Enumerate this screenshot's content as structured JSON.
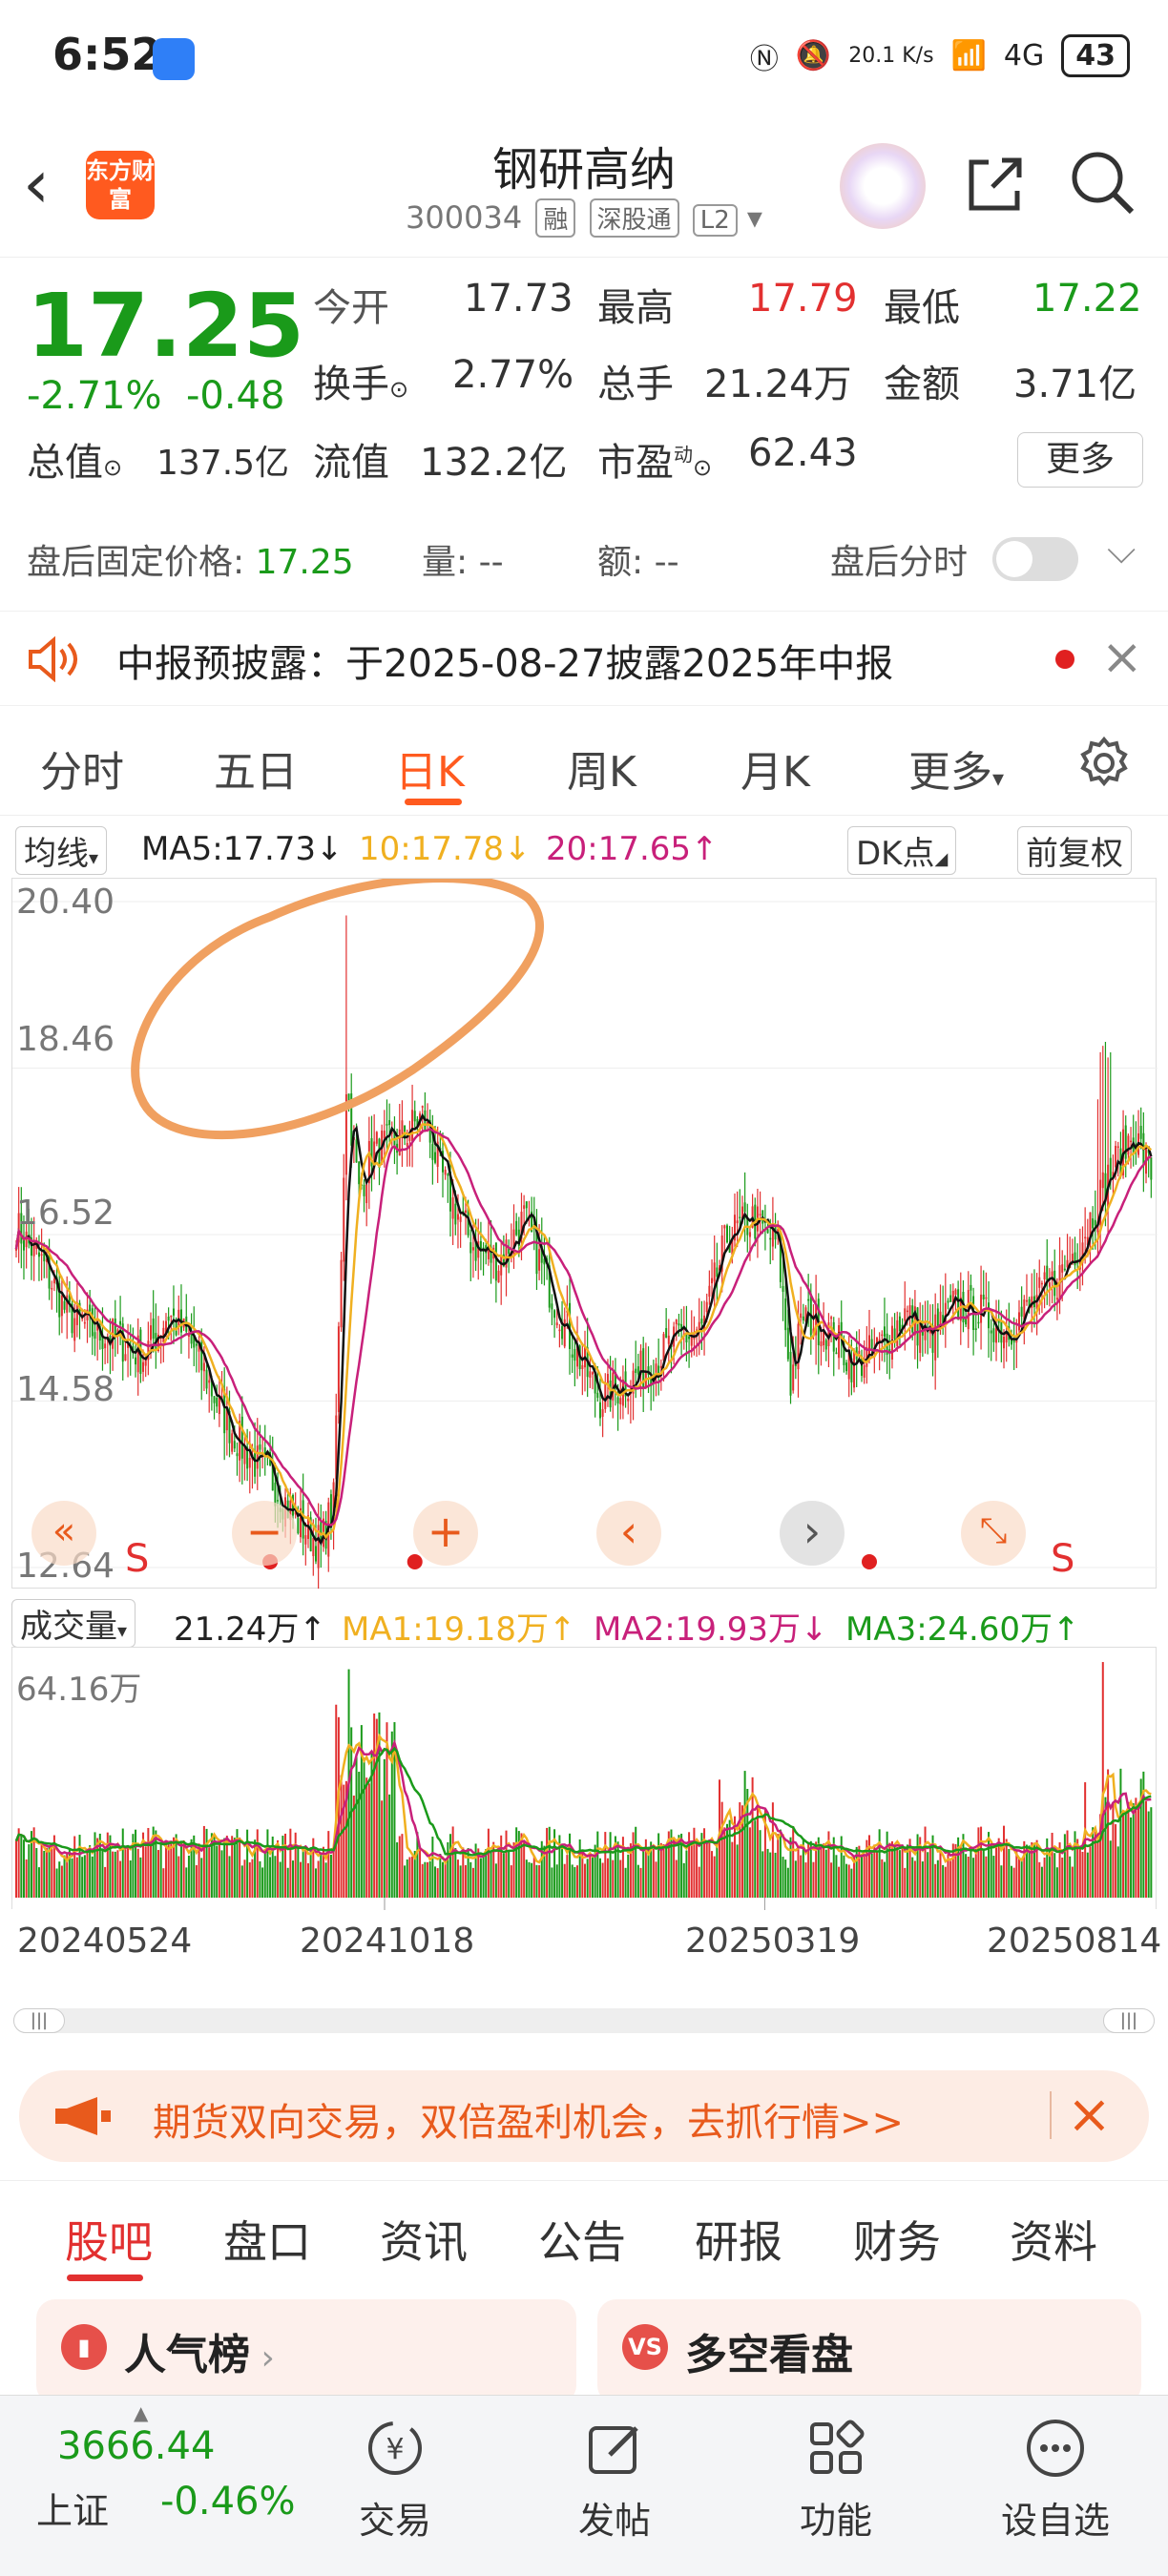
{
  "status_bar": {
    "time": "6:52",
    "net_speed": "20.1 K/s",
    "signal": "4G",
    "battery": "43"
  },
  "header": {
    "title": "钢研高纳",
    "code": "300034",
    "tags": [
      "融",
      "深股通",
      "L2"
    ],
    "logo_text": "东方财富"
  },
  "quote": {
    "price": "17.25",
    "change_pct": "-2.71%",
    "change_amt": "-0.48",
    "open_label": "今开",
    "open": "17.73",
    "high_label": "最高",
    "high": "17.79",
    "low_label": "最低",
    "low": "17.22",
    "turnover_label": "换手",
    "turnover": "2.77%",
    "volume_label": "总手",
    "volume": "21.24万",
    "amount_label": "金额",
    "amount": "3.71亿",
    "mktcap_label": "总值",
    "mktcap": "137.5亿",
    "float_label": "流值",
    "float": "132.2亿",
    "pe_label": "市盈",
    "pe_sup": "动",
    "pe": "62.43",
    "more": "更多"
  },
  "after_hours": {
    "label": "盘后固定价格:",
    "price": "17.25",
    "vol_label": "量:",
    "vol": "--",
    "amt_label": "额:",
    "amt": "--",
    "toggle_label": "盘后分时"
  },
  "notice": {
    "text": "中报预披露：于2025-08-27披露2025年中报"
  },
  "tabs": [
    "分时",
    "五日",
    "日K",
    "周K",
    "月K",
    "更多"
  ],
  "ma_bar": {
    "selector": "均线",
    "ma5": "MA5:17.73↓",
    "ma10": "10:17.78↓",
    "ma20": "20:17.65↑",
    "dk": "DK点",
    "adjust": "前复权"
  },
  "chart_data": {
    "type": "candlestick",
    "y_ticks": [
      "20.40",
      "18.46",
      "16.52",
      "14.58",
      "12.64"
    ],
    "ylim": [
      12.64,
      20.4
    ],
    "x_labels": [
      "20240524",
      "20241018",
      "20250319",
      "20250814"
    ],
    "volume_max_label": "64.16万",
    "signal_markers": [
      "S",
      "S"
    ],
    "colors": {
      "up": "#e23030",
      "down": "#1a9a1a",
      "ma5": "#111111",
      "ma10": "#f0b020",
      "ma20": "#c8207a"
    },
    "close_path": [
      [
        0,
        16.6
      ],
      [
        10,
        16.2
      ],
      [
        20,
        15.6
      ],
      [
        30,
        15.4
      ],
      [
        40,
        15.3
      ],
      [
        50,
        15.1
      ],
      [
        60,
        15.6
      ],
      [
        70,
        15.2
      ],
      [
        80,
        14.5
      ],
      [
        90,
        14.0
      ],
      [
        100,
        13.7
      ],
      [
        110,
        13.2
      ],
      [
        120,
        12.9
      ],
      [
        125,
        13.4
      ],
      [
        130,
        18.3
      ],
      [
        135,
        17.0
      ],
      [
        140,
        17.5
      ],
      [
        150,
        17.6
      ],
      [
        160,
        17.9
      ],
      [
        170,
        17.0
      ],
      [
        180,
        16.4
      ],
      [
        190,
        16.2
      ],
      [
        200,
        16.7
      ],
      [
        210,
        15.9
      ],
      [
        220,
        15.2
      ],
      [
        230,
        14.6
      ],
      [
        240,
        14.8
      ],
      [
        250,
        15.0
      ],
      [
        260,
        15.3
      ],
      [
        270,
        15.4
      ],
      [
        280,
        16.5
      ],
      [
        290,
        16.7
      ],
      [
        300,
        16.4
      ],
      [
        305,
        14.8
      ],
      [
        310,
        15.6
      ],
      [
        320,
        15.4
      ],
      [
        330,
        15.0
      ],
      [
        340,
        15.2
      ],
      [
        350,
        15.6
      ],
      [
        360,
        15.3
      ],
      [
        370,
        15.7
      ],
      [
        380,
        15.6
      ],
      [
        390,
        15.4
      ],
      [
        400,
        15.7
      ],
      [
        410,
        16.0
      ],
      [
        420,
        16.5
      ],
      [
        430,
        17.2
      ],
      [
        440,
        17.7
      ],
      [
        447,
        17.25
      ]
    ],
    "ma20_path": [
      [
        0,
        16.6
      ],
      [
        20,
        16.0
      ],
      [
        40,
        15.6
      ],
      [
        60,
        15.3
      ],
      [
        80,
        14.8
      ],
      [
        100,
        14.0
      ],
      [
        120,
        13.1
      ],
      [
        130,
        14.5
      ],
      [
        140,
        16.2
      ],
      [
        160,
        17.4
      ],
      [
        180,
        16.8
      ],
      [
        200,
        16.4
      ],
      [
        220,
        15.7
      ],
      [
        240,
        15.0
      ],
      [
        260,
        15.1
      ],
      [
        280,
        15.8
      ],
      [
        300,
        16.3
      ],
      [
        320,
        15.6
      ],
      [
        340,
        15.3
      ],
      [
        360,
        15.4
      ],
      [
        380,
        15.5
      ],
      [
        400,
        15.6
      ],
      [
        420,
        16.0
      ],
      [
        447,
        17.65
      ]
    ],
    "annotation": "hand-drawn orange circle around the October 2024 spike"
  },
  "volume_bar": {
    "selector": "成交量",
    "vol": "21.24万↑",
    "ma1": "MA1:19.18万↑",
    "ma2": "MA2:19.93万↓",
    "ma3": "MA3:24.60万↑"
  },
  "promo": {
    "text": "期货双向交易，双倍盈利机会，去抓行情>>"
  },
  "bottom_tabs": [
    "股吧",
    "盘口",
    "资讯",
    "公告",
    "研报",
    "财务",
    "资料"
  ],
  "cards": [
    {
      "title": "人气榜"
    },
    {
      "title": "多空看盘"
    }
  ],
  "index": {
    "value": "3666.44",
    "name": "上证",
    "change": "-0.46%"
  },
  "nav": [
    "交易",
    "发帖",
    "功能",
    "设自选"
  ]
}
